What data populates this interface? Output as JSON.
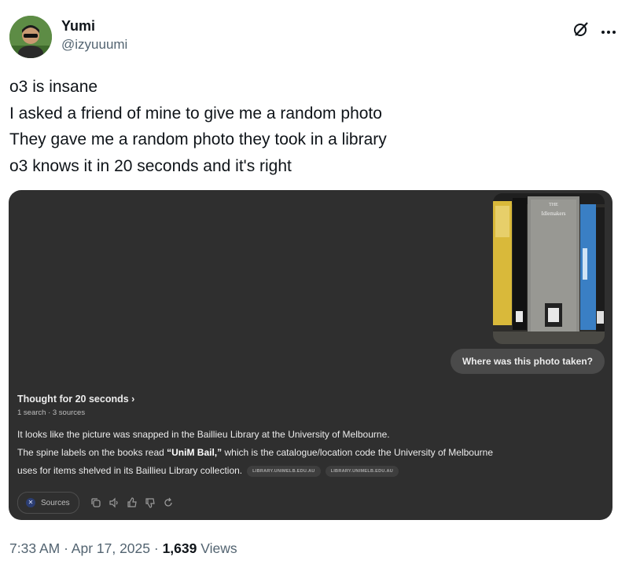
{
  "author": {
    "display_name": "Yumi",
    "handle": "@izyuuumi"
  },
  "tweet": {
    "lines": [
      "o3 is insane",
      "I asked a friend of mine to give me a random photo",
      "They gave me a random photo they took in a library",
      "o3 knows it in 20 seconds and it's right"
    ]
  },
  "photo": {
    "spine_label_center": "THE",
    "spine_label_center_2": "Idlemakers"
  },
  "chat": {
    "question": "Where was this photo taken?",
    "thought_title": "Thought for 20 seconds",
    "thought_chevron": "›",
    "thought_sub": "1 search · 3 sources",
    "answer_line1": "It looks like the picture was snapped in the Baillieu Library at the University of Melbourne.",
    "answer_line2_pre": "The spine labels on the books read ",
    "answer_line2_bold": "“UniM Bail,”",
    "answer_line2_post": " which is the catalogue/location code the University of Melbourne",
    "answer_line3": "uses for items shelved in its Baillieu Library collection.",
    "chip_1": "LIBRARY.UNIMELB.EDU.AU",
    "chip_2": "LIBRARY.UNIMELB.EDU.AU",
    "sources_label": "Sources"
  },
  "meta": {
    "time_date": "7:33 AM · Apr 17, 2025 · ",
    "views_count": "1,639",
    "views_label": " Views"
  },
  "icons": {
    "grok": "slash-circle-icon",
    "more": "more-icon",
    "copy": "copy-icon",
    "speaker": "speaker-icon",
    "thumbs_up": "thumbs-up-icon",
    "thumbs_down": "thumbs-down-icon",
    "regenerate": "regenerate-icon"
  },
  "colors": {
    "chat_bg": "#2f2f2f",
    "muted": "#536471",
    "text": "#0f1419"
  }
}
